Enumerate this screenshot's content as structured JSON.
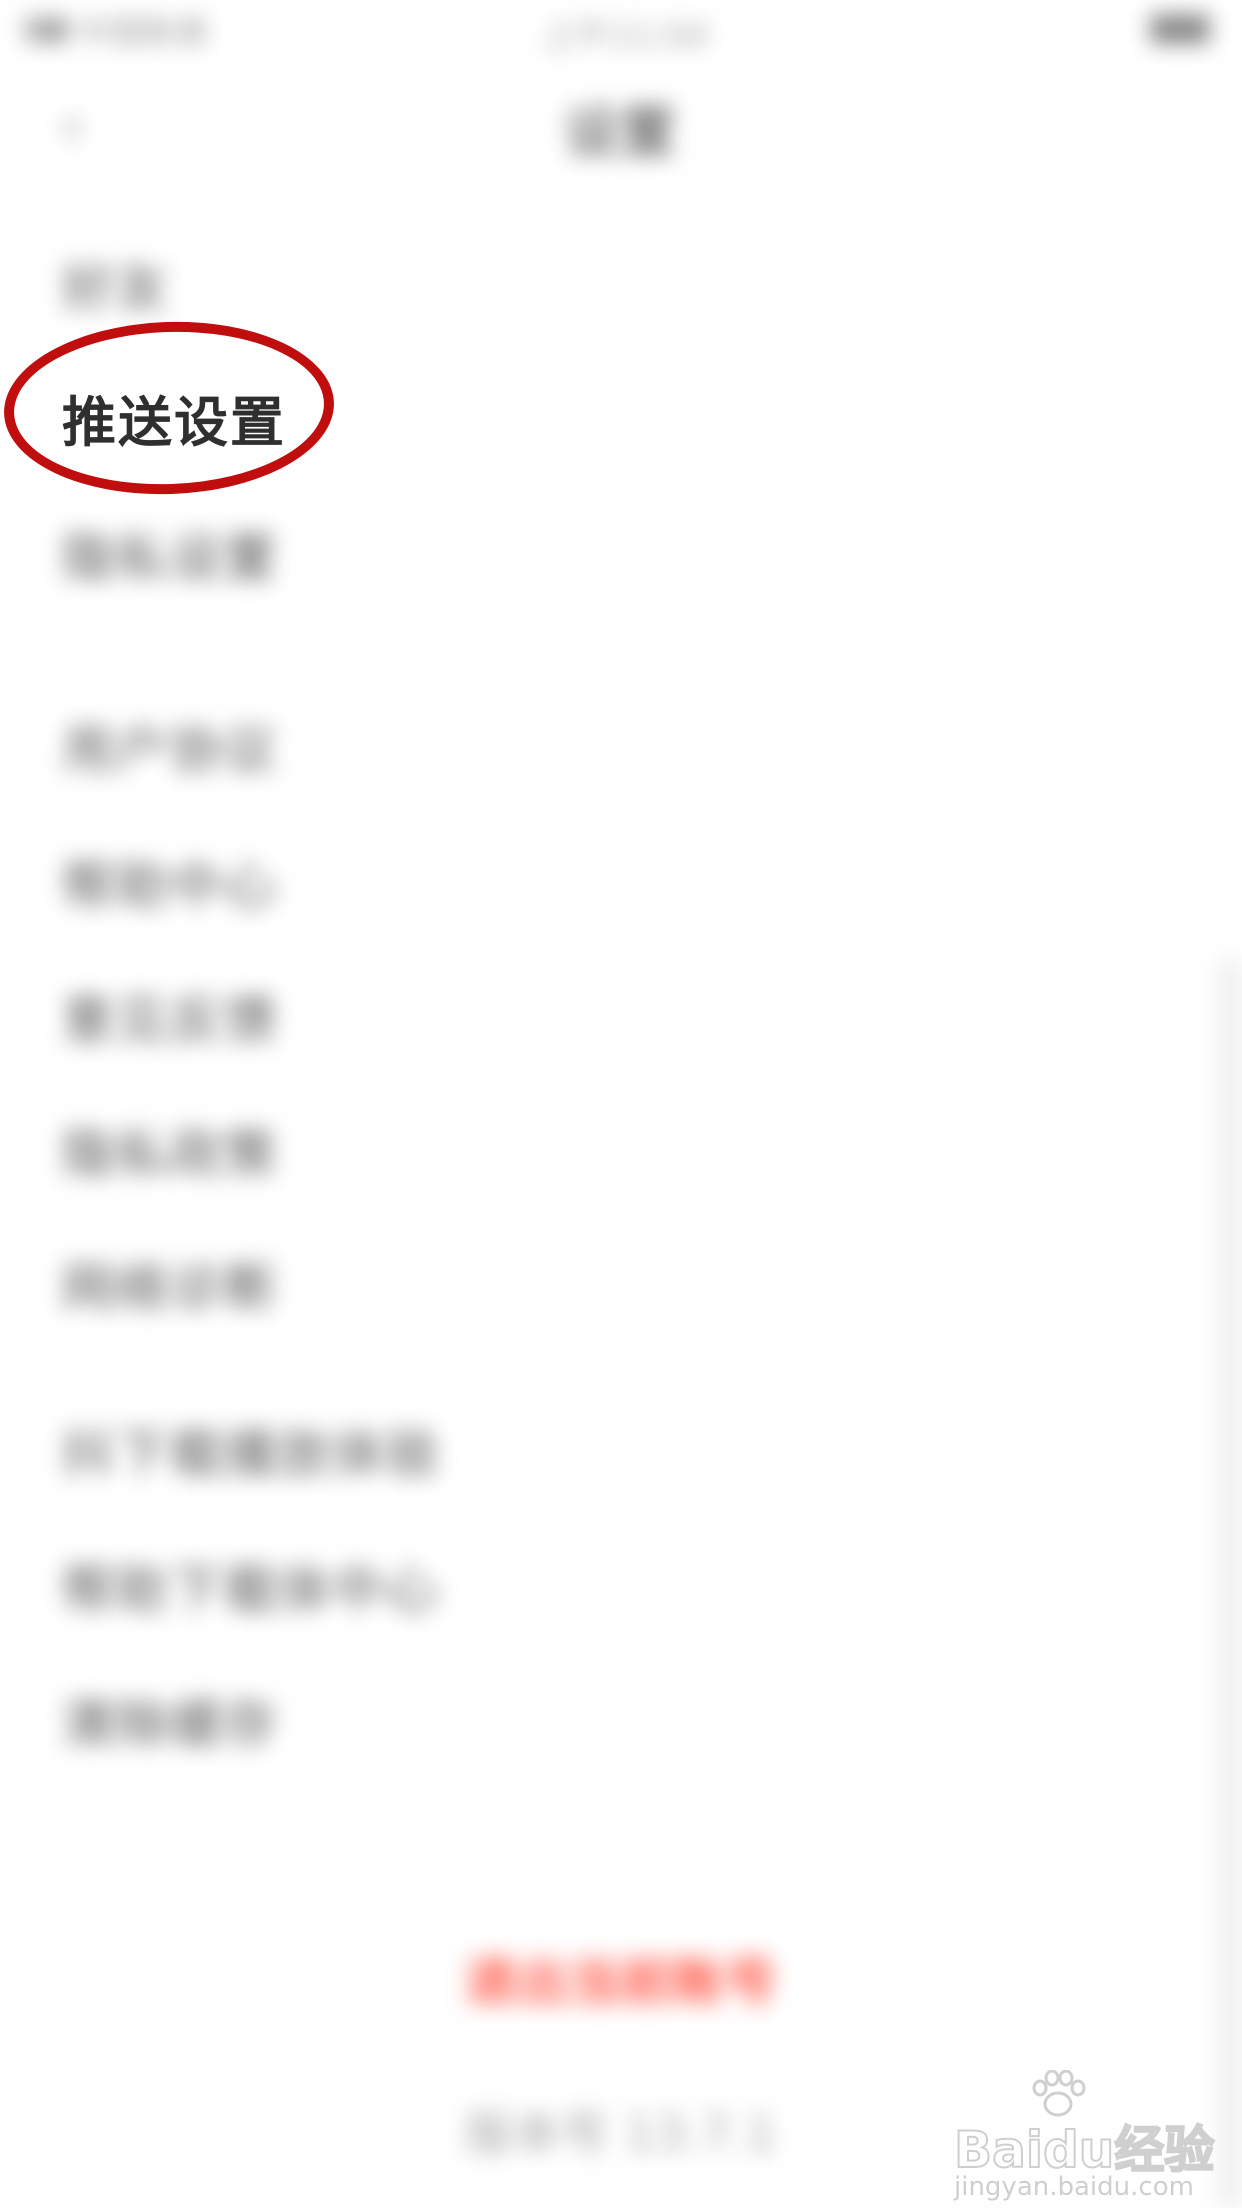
{
  "status_bar": {
    "carrier": "中国联通",
    "time": "上午11:04"
  },
  "header": {
    "title": "设置"
  },
  "menu": {
    "items": [
      {
        "label": "好友"
      },
      {
        "label": "推送设置"
      },
      {
        "label": "隐私设置"
      },
      {
        "label": "用户协议"
      },
      {
        "label": "帮助中心"
      },
      {
        "label": "意见反馈"
      },
      {
        "label": "隐私政策"
      },
      {
        "label": "网络诊断"
      },
      {
        "label": "抖下载播放体验"
      },
      {
        "label": "帮助下载体中心"
      },
      {
        "label": "清除缓存"
      }
    ]
  },
  "footer": {
    "logout_label": "退出当前账号",
    "version_label": "版本号 13.7.1"
  },
  "annotation": {
    "highlighted_label": "推送设置",
    "circle_color": "#c00d0d"
  },
  "watermark": {
    "brand": "Baidu经验",
    "url": "jingyan.baidu.com"
  },
  "colors": {
    "accent": "#ff5a4a",
    "text_blur": "#8a8a8a",
    "text_sharp": "#2f2f2f"
  }
}
